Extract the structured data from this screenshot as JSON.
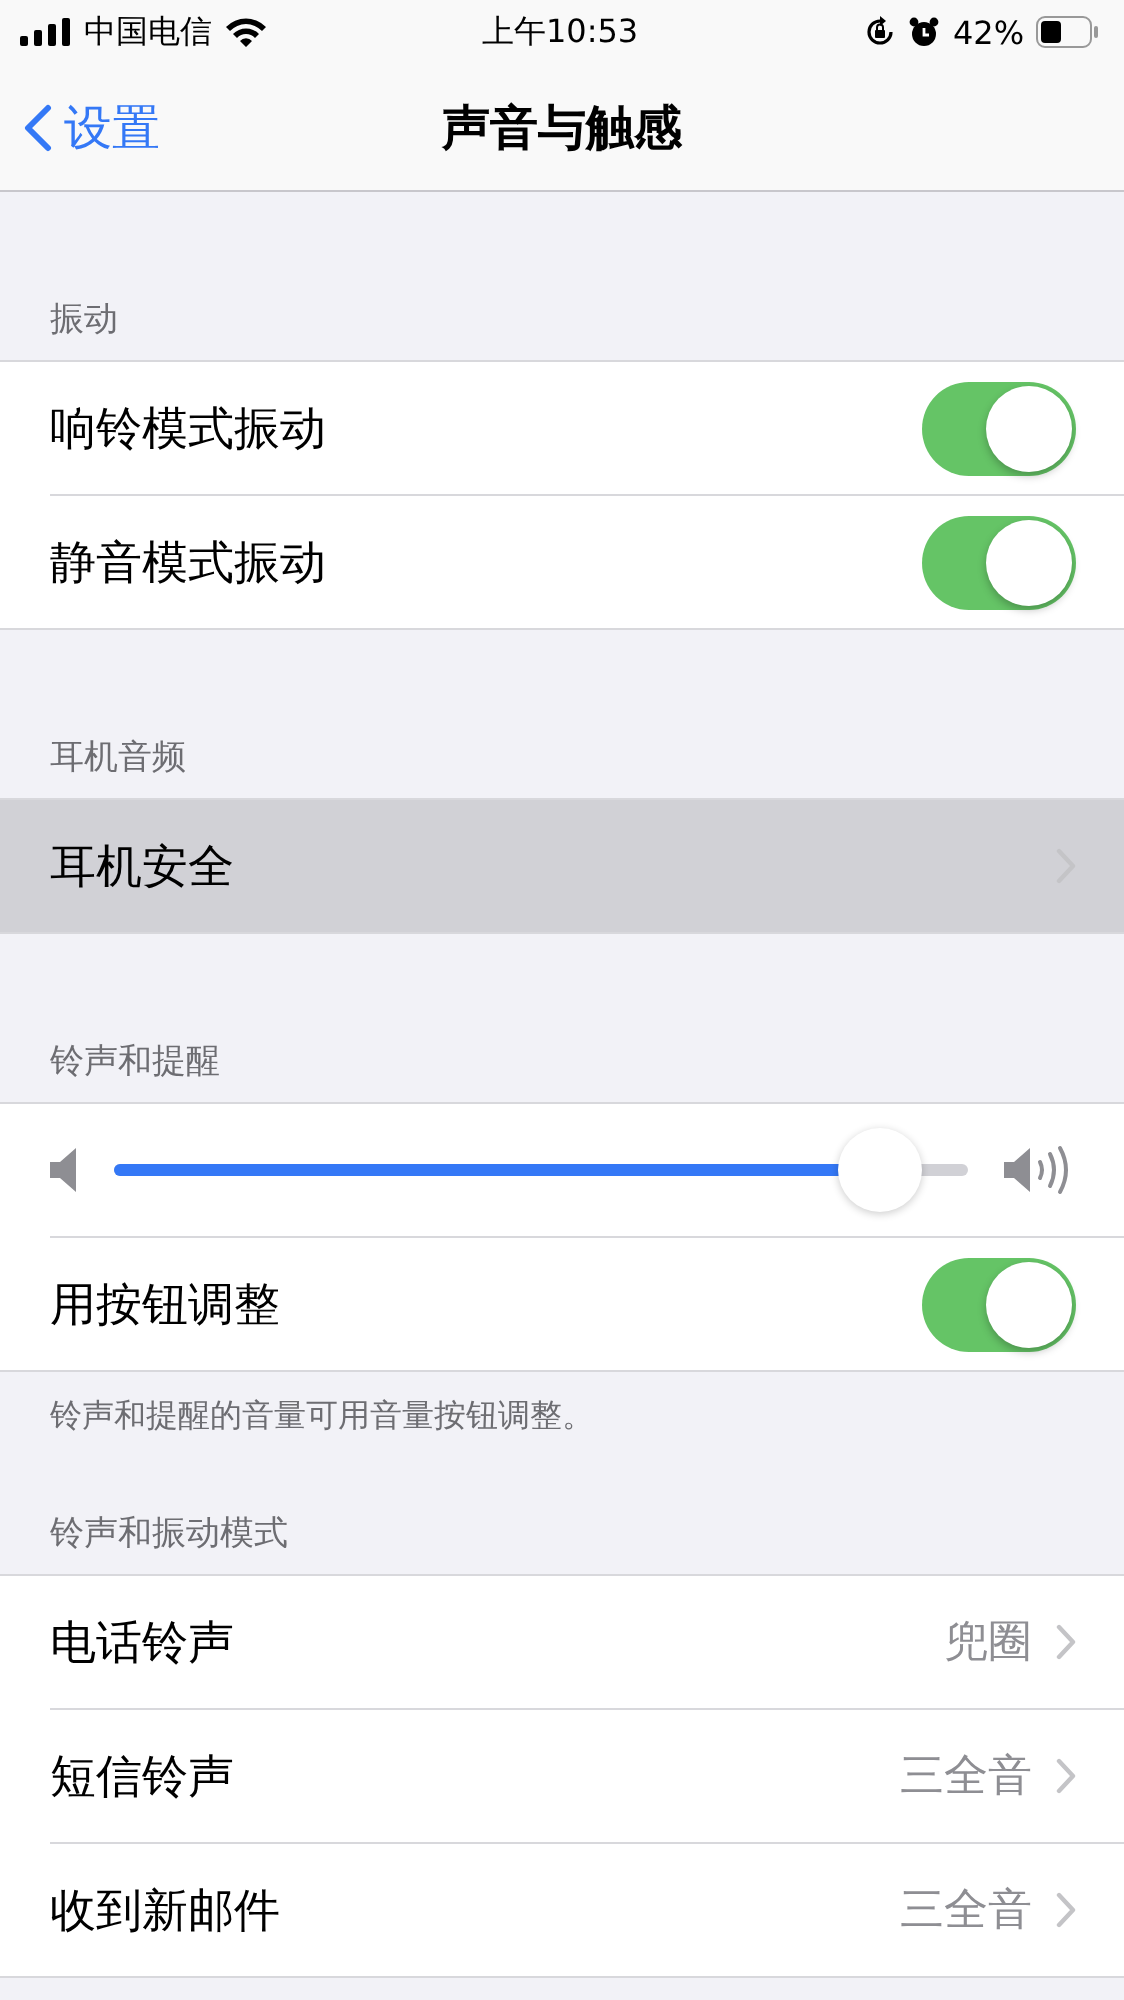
{
  "status_bar": {
    "carrier": "中国电信",
    "time": "上午10:53",
    "battery": "42%"
  },
  "nav": {
    "back": "设置",
    "title": "声音与触感"
  },
  "sections": [
    {
      "header": "振动",
      "rows": [
        {
          "kind": "toggle",
          "label": "响铃模式振动",
          "on": true
        },
        {
          "kind": "toggle",
          "label": "静音模式振动",
          "on": true
        }
      ]
    },
    {
      "header": "耳机音频",
      "rows": [
        {
          "kind": "link",
          "label": "耳机安全",
          "selected": true
        }
      ]
    },
    {
      "header": "铃声和提醒",
      "rows": [
        {
          "kind": "slider",
          "level": 0.94
        },
        {
          "kind": "toggle",
          "label": "用按钮调整",
          "on": true
        }
      ],
      "footer": "铃声和提醒的音量可用音量按钮调整。"
    },
    {
      "header": "铃声和振动模式",
      "rows": [
        {
          "kind": "link",
          "label": "电话铃声",
          "value": "兜圈",
          "selected": false
        },
        {
          "kind": "link",
          "label": "短信铃声",
          "value": "三全音",
          "selected": false
        },
        {
          "kind": "link",
          "label": "收到新邮件",
          "value": "三全音",
          "selected": false
        }
      ]
    }
  ]
}
